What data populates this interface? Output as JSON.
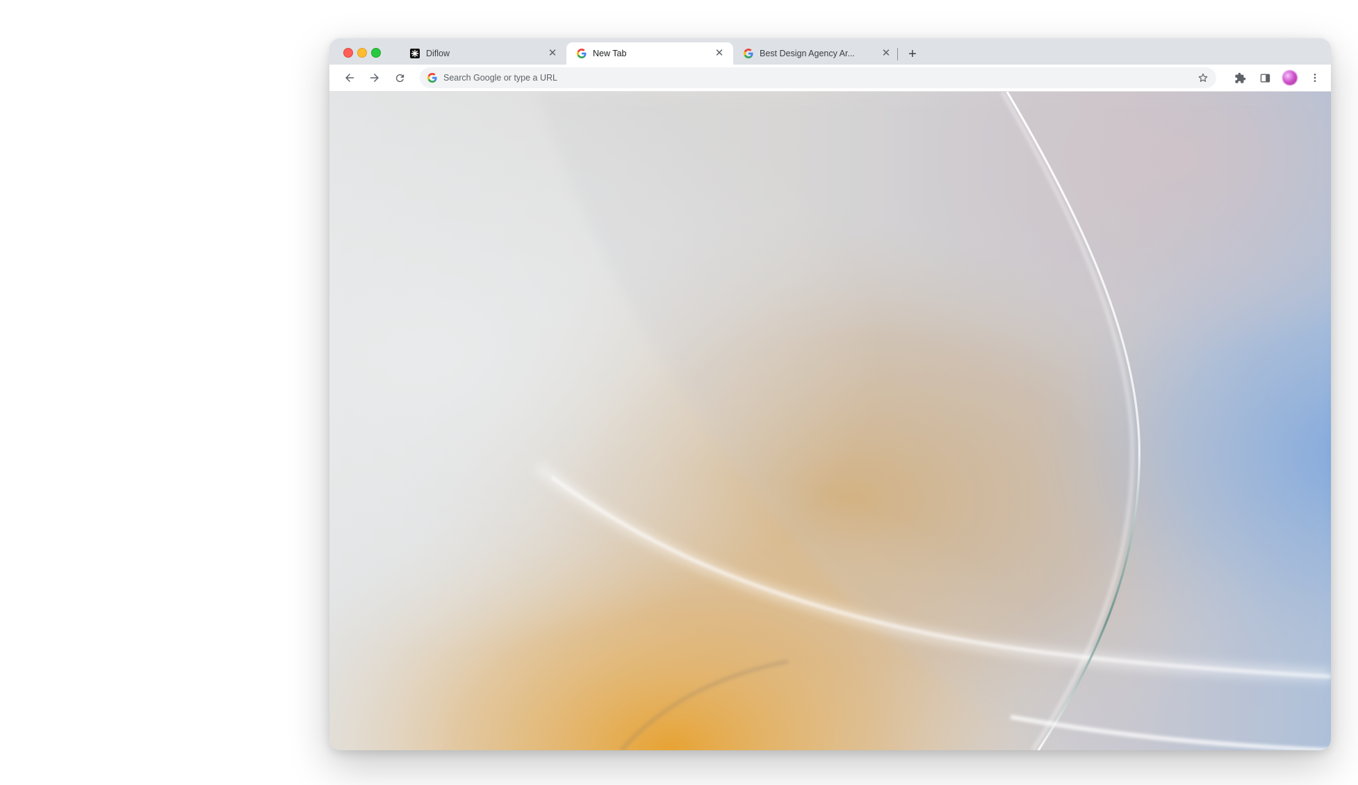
{
  "window": {
    "traffic_lights": [
      "close",
      "minimize",
      "zoom"
    ]
  },
  "tabs": [
    {
      "title": "Diflow",
      "favicon": "diflow-logo-icon",
      "active": false
    },
    {
      "title": "New Tab",
      "favicon": "google-g-icon",
      "active": true
    },
    {
      "title": "Best Design Agency Ar...",
      "favicon": "google-g-icon",
      "active": false
    }
  ],
  "toolbar": {
    "omnibox_placeholder": "Search Google or type a URL",
    "icons": [
      "back-arrow-icon",
      "forward-arrow-icon",
      "reload-icon",
      "bookmark-star-icon",
      "extensions-puzzle-icon",
      "side-panel-icon",
      "profile-avatar",
      "more-vert-icon"
    ]
  },
  "colors": {
    "tabstrip": "#dee1e6",
    "active_tab": "#ffffff",
    "omnibox": "#f1f3f4",
    "wallpaper_warm": "#e3a43a",
    "wallpaper_cool": "#7aa6de"
  }
}
